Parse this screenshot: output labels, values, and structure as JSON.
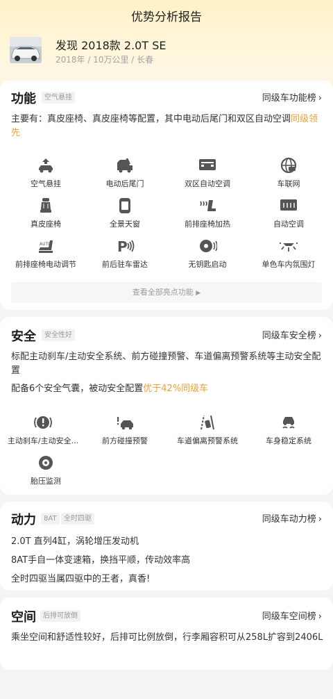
{
  "page": {
    "title": "优势分析报告"
  },
  "car": {
    "name": "发现 2018款 2.0T SE",
    "meta": "2018年 / 10万公里 / 长春"
  },
  "function": {
    "title": "功能",
    "tag": "空气悬挂",
    "link": "同级车功能榜",
    "desc_pre": "主要有：真皮座椅、真皮座椅等配置，其中电动后尾门和双区自动空调",
    "desc_hl": "同级领先",
    "icons": [
      {
        "label": "空气悬挂",
        "icon": "air-suspension-icon"
      },
      {
        "label": "电动后尾门",
        "icon": "power-tailgate-icon"
      },
      {
        "label": "双区自动空调",
        "icon": "dual-zone-ac-icon"
      },
      {
        "label": "车联网",
        "icon": "connected-car-icon"
      },
      {
        "label": "真皮座椅",
        "icon": "leather-seat-icon"
      },
      {
        "label": "全景天窗",
        "icon": "panoramic-sunroof-icon"
      },
      {
        "label": "前排座椅加热",
        "icon": "seat-heating-icon"
      },
      {
        "label": "自动空调",
        "icon": "auto-ac-icon"
      },
      {
        "label": "前排座椅电动调节",
        "icon": "power-seat-adjust-icon"
      },
      {
        "label": "前后驻车雷达",
        "icon": "parking-radar-icon"
      },
      {
        "label": "无钥匙启动",
        "icon": "keyless-start-icon"
      },
      {
        "label": "单色车内氛围灯",
        "icon": "ambient-light-icon"
      }
    ],
    "more": "查看全部亮点功能"
  },
  "safety": {
    "title": "安全",
    "tag": "安全性好",
    "link": "同级车安全榜",
    "desc1": "标配主动刹车/主动安全系统、前方碰撞预警、车道偏离预警系统等主动安全配置",
    "desc2_pre": "配备6个安全气囊，被动安全配置",
    "desc2_hl": "优于42%同级车",
    "icons": [
      {
        "label": "主动刹车/主动安全...",
        "icon": "active-brake-icon"
      },
      {
        "label": "前方碰撞预警",
        "icon": "collision-warning-icon"
      },
      {
        "label": "车道偏离预警系统",
        "icon": "lane-departure-icon"
      },
      {
        "label": "车身稳定系统",
        "icon": "stability-control-icon"
      },
      {
        "label": "胎压监测",
        "icon": "tire-pressure-icon"
      }
    ]
  },
  "power": {
    "title": "动力",
    "tags": [
      "8AT",
      "全时四驱"
    ],
    "link": "同级车动力榜",
    "lines": [
      "2.0T 直列4缸，涡轮增压发动机",
      "8AT手自一体变速箱，换挡平顺，传动效率高",
      "全时四驱当属四驱中的王者，真香!"
    ]
  },
  "space": {
    "title": "空间",
    "tag": "后排可放倒",
    "link": "同级车空间榜",
    "desc": "乘坐空间和舒适性较好，后排可比例放倒，行李厢容积可从258L扩容到2406L"
  },
  "colors": {
    "accent": "#e6a23c",
    "icon": "#555555"
  }
}
